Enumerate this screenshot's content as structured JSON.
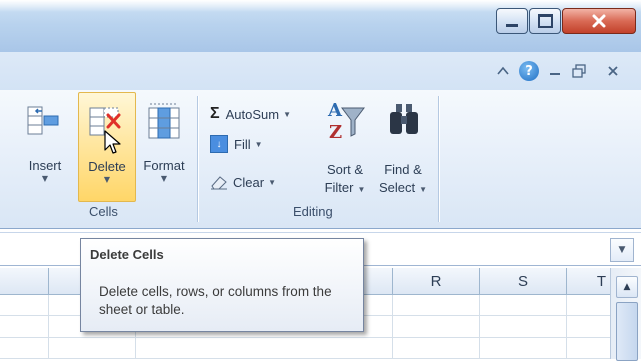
{
  "window": {
    "controls": {
      "minimize_icon": "minimize-icon",
      "maximize_icon": "maximize-icon",
      "close_icon": "close-icon"
    }
  },
  "doc_bar": {
    "help_glyph": "?"
  },
  "ribbon": {
    "cells_group": {
      "label": "Cells",
      "insert_label": "Insert",
      "delete_label": "Delete",
      "format_label": "Format"
    },
    "editing_group": {
      "label": "Editing",
      "autosum_label": "AutoSum",
      "fill_label": "Fill",
      "clear_label": "Clear",
      "sort_label_1": "Sort &",
      "sort_label_2": "Filter",
      "find_label_1": "Find &",
      "find_label_2": "Select"
    }
  },
  "columns": [
    "",
    "",
    "",
    "R",
    "S",
    "T"
  ],
  "tooltip": {
    "title": "Delete Cells",
    "body": "Delete cells, rows, or columns from the sheet or table."
  },
  "colors": {
    "highlight": "#ffd668",
    "ribbon_bg": "#e5eef9",
    "title_bar": "#b9d3ee"
  }
}
